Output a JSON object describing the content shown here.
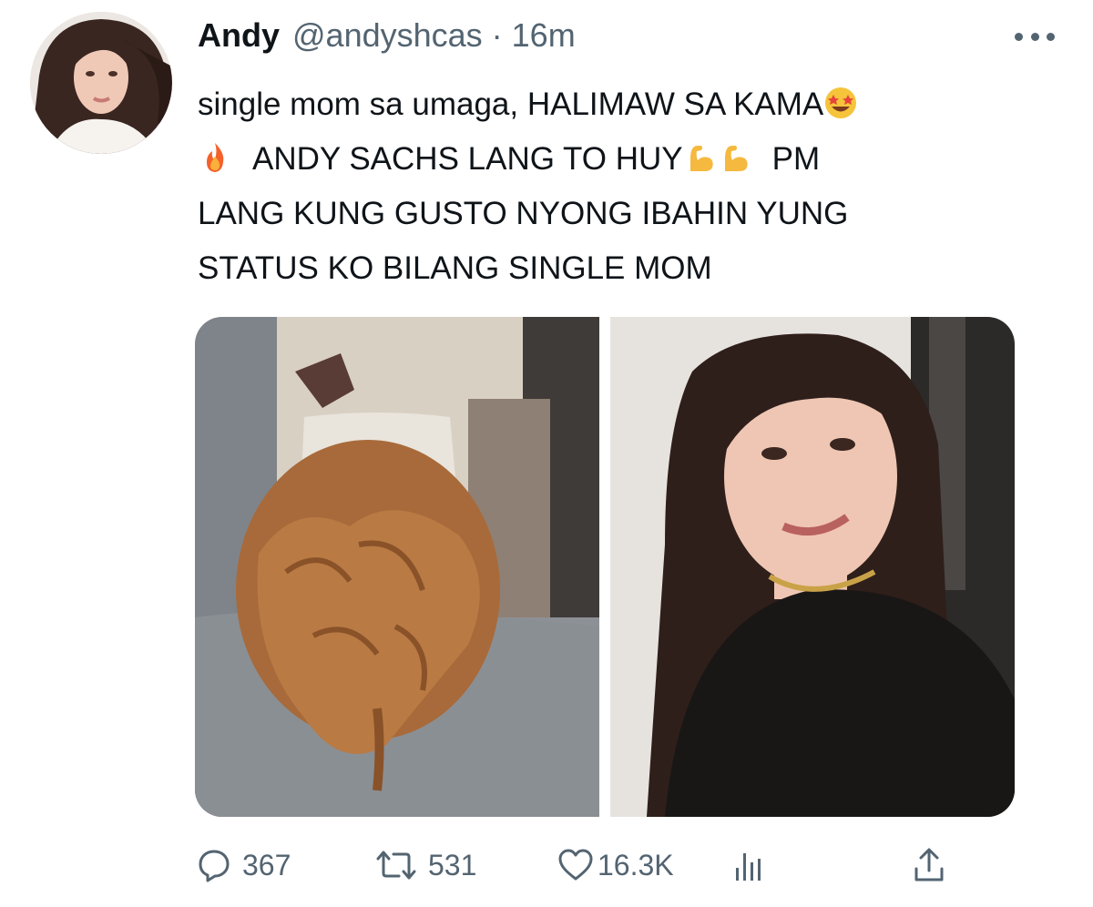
{
  "tweet": {
    "author_name": "Andy",
    "handle": "@andyshcas",
    "separator": "·",
    "time": "16m",
    "text_lines": [
      "single mom sa umaga, HALIMAW SA KAMA",
      "ANDY SACHS LANG TO HUY",
      "PM",
      "LANG KUNG GUSTO NYONG IBAHIN YUNG",
      "STATUS KO BILANG SINGLE MOM"
    ],
    "emojis": [
      "star-struck-emoji",
      "fire-emoji",
      "flexed-biceps-emoji",
      "flexed-biceps-emoji"
    ]
  },
  "media": {
    "images": [
      "photo-curly-hair-child",
      "photo-woman-selfie"
    ]
  },
  "actions": {
    "replies": "367",
    "retweets": "531",
    "likes": "16.3K"
  },
  "icons": [
    "more-options-icon",
    "reply-icon",
    "retweet-icon",
    "like-icon",
    "analytics-icon",
    "share-icon"
  ],
  "colors": {
    "text": "#0f1419",
    "secondary": "#536471"
  }
}
